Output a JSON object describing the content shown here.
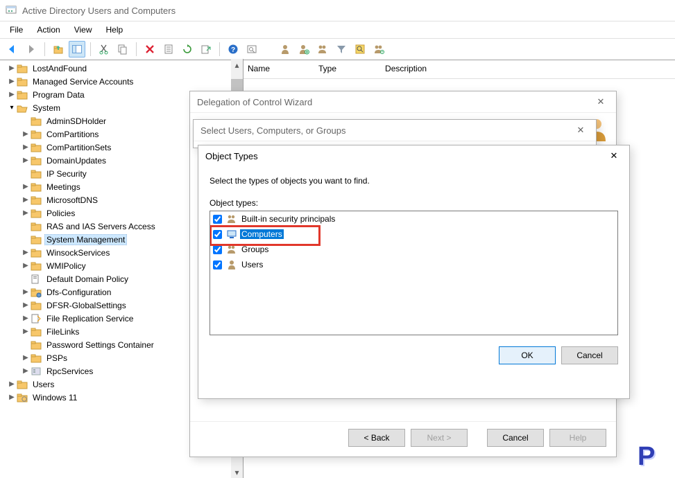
{
  "window": {
    "title": "Active Directory Users and Computers"
  },
  "menu": {
    "file": "File",
    "action": "Action",
    "view": "View",
    "help": "Help"
  },
  "tree": {
    "lostandfound": "LostAndFound",
    "msa": "Managed Service Accounts",
    "programdata": "Program Data",
    "system": "System",
    "adminsdholder": "AdminSDHolder",
    "compartitions": "ComPartitions",
    "compartitionsets": "ComPartitionSets",
    "domainupdates": "DomainUpdates",
    "ipsecurity": "IP Security",
    "meetings": "Meetings",
    "microsoftdns": "MicrosoftDNS",
    "policies": "Policies",
    "rasias": "RAS and IAS Servers Access",
    "sysmgmt": "System Management",
    "winsock": "WinsockServices",
    "wmipolicy": "WMIPolicy",
    "defaultdomainpolicy": "Default Domain Policy",
    "dfsconfig": "Dfs-Configuration",
    "dfsrglobal": "DFSR-GlobalSettings",
    "frs": "File Replication Service",
    "filelinks": "FileLinks",
    "pwdsettings": "Password Settings Container",
    "psps": "PSPs",
    "rpcservices": "RpcServices",
    "users": "Users",
    "windows11": "Windows 11"
  },
  "list_header": {
    "name": "Name",
    "type": "Type",
    "description": "Description"
  },
  "wizard": {
    "title": "Delegation of Control Wizard",
    "back": "< Back",
    "next": "Next >",
    "cancel": "Cancel",
    "help": "Help"
  },
  "select": {
    "title": "Select Users, Computers, or Groups"
  },
  "object_types": {
    "title": "Object Types",
    "instruction": "Select the types of objects you want to find.",
    "list_label": "Object types:",
    "options": {
      "builtin": "Built-in security principals",
      "computers": "Computers",
      "groups": "Groups",
      "users": "Users"
    },
    "ok": "OK",
    "cancel": "Cancel"
  }
}
